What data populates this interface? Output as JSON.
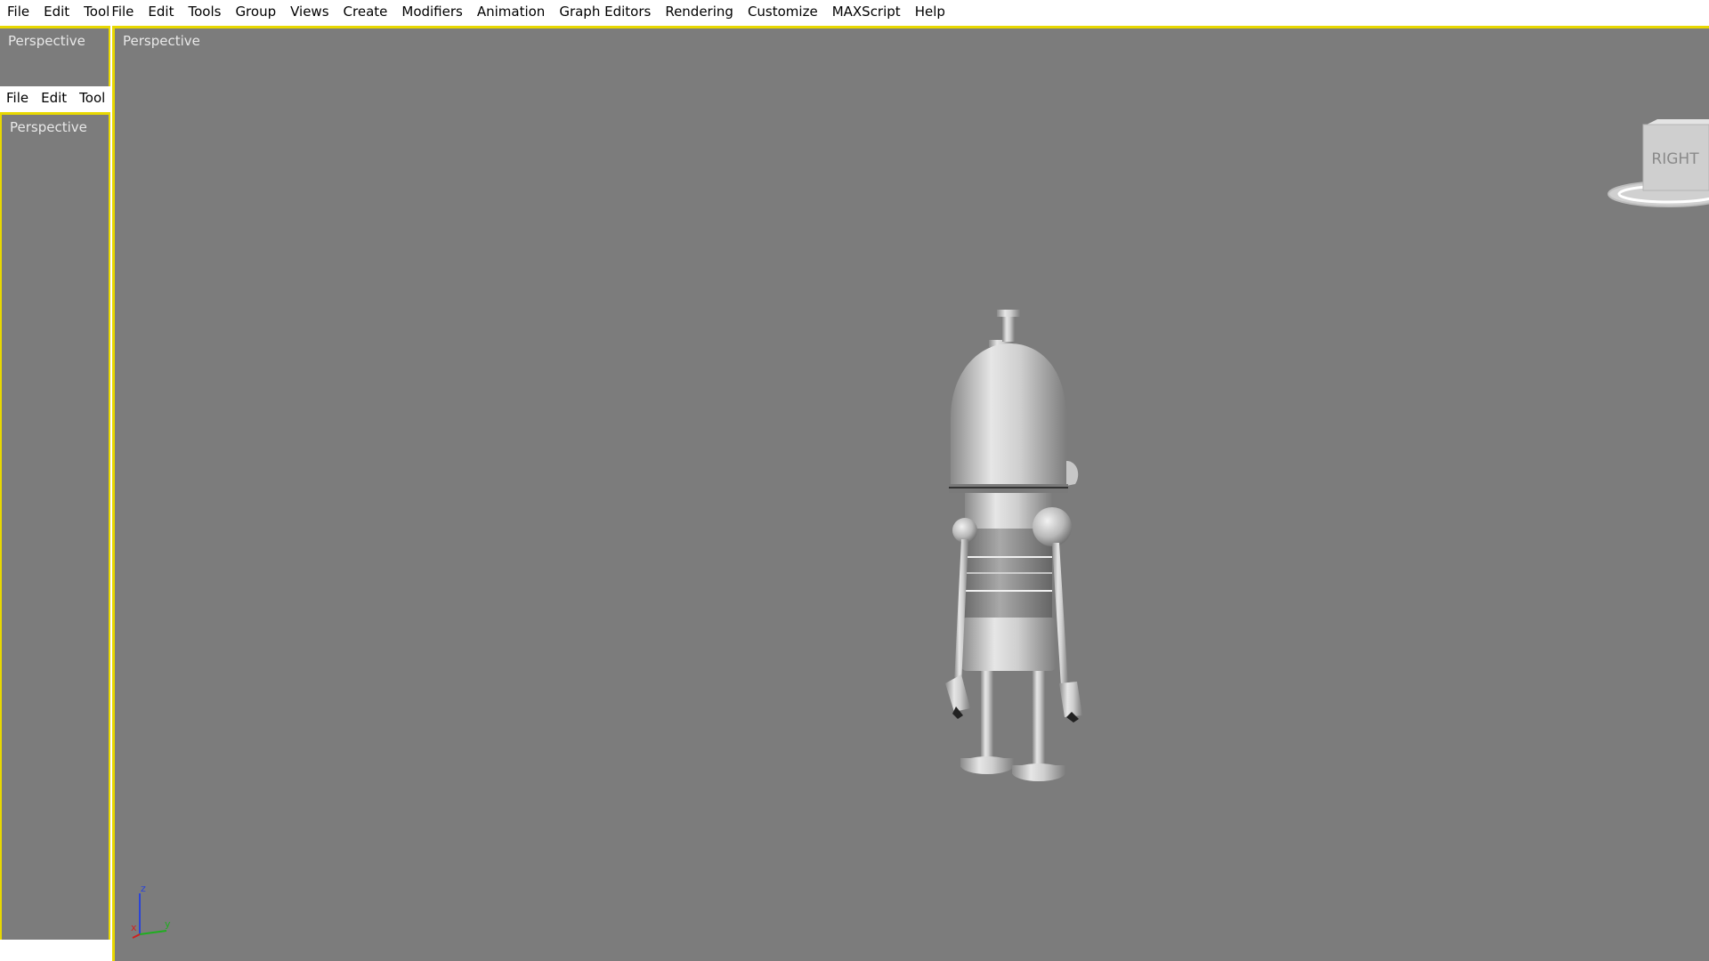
{
  "menus": {
    "main": [
      "File",
      "Edit",
      "Tool",
      "File",
      "Edit",
      "Tools",
      "Group",
      "Views",
      "Create",
      "Modifiers",
      "Animation",
      "Graph Editors",
      "Rendering",
      "Customize",
      "MAXScript",
      "Help"
    ],
    "mini": [
      "File",
      "Edit",
      "Tool"
    ]
  },
  "viewports": {
    "main_label": "Perspective",
    "small_1_label": "Perspective",
    "small_2_label": "Perspective"
  },
  "viewcube": {
    "face_label": "RIGHT"
  },
  "axis_tripod": {
    "x": "x",
    "y": "y",
    "z": "z"
  },
  "colors": {
    "viewport_bg": "#7c7c7c",
    "active_border": "#e8d800",
    "axis_x": "#d02020",
    "axis_y": "#1fae1f",
    "axis_z": "#2a44d8"
  },
  "icons": {
    "robot": "robot-model",
    "viewcube": "viewcube-icon",
    "axis": "axis-tripod-icon"
  }
}
